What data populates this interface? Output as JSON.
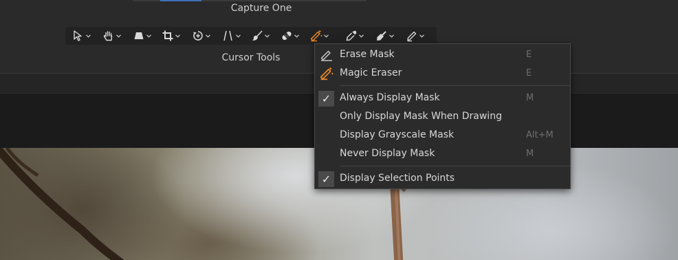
{
  "app": {
    "title": "Capture One"
  },
  "toolbar": {
    "label": "Cursor Tools",
    "tools": [
      {
        "name": "select-tool",
        "icon": "arrow-cursor-icon"
      },
      {
        "name": "pan-tool",
        "icon": "hand-icon"
      },
      {
        "name": "keystone-tool",
        "icon": "keystone-icon"
      },
      {
        "name": "crop-tool",
        "icon": "crop-icon"
      },
      {
        "name": "rotate-tool",
        "icon": "rotate-icon"
      },
      {
        "name": "keystone-lines-tool",
        "icon": "lines-icon"
      },
      {
        "name": "brush-tool",
        "icon": "brush-icon"
      },
      {
        "name": "heal-tool",
        "icon": "bandage-icon"
      },
      {
        "name": "magic-eraser-tool",
        "icon": "magic-eraser-icon",
        "active": true
      },
      {
        "name": "color-picker-tool",
        "icon": "eyedropper-icon"
      },
      {
        "name": "white-balance-tool",
        "icon": "dropper-fill-icon"
      },
      {
        "name": "annotate-tool",
        "icon": "pencil-icon"
      }
    ],
    "accent_color": "#f08a24"
  },
  "menu": {
    "items": [
      {
        "label": "Erase Mask",
        "shortcut": "E",
        "icon": "eraser-icon"
      },
      {
        "label": "Magic Eraser",
        "shortcut": "E",
        "icon": "magic-eraser-icon"
      },
      {
        "label": "Always Display Mask",
        "shortcut": "M",
        "checked": true
      },
      {
        "label": "Only Display Mask When Drawing",
        "shortcut": ""
      },
      {
        "label": "Display Grayscale Mask",
        "shortcut": "Alt+M"
      },
      {
        "label": "Never Display Mask",
        "shortcut": "M"
      },
      {
        "label": "Display Selection Points",
        "shortcut": "",
        "checked": true
      }
    ],
    "check_glyph": "✓"
  }
}
